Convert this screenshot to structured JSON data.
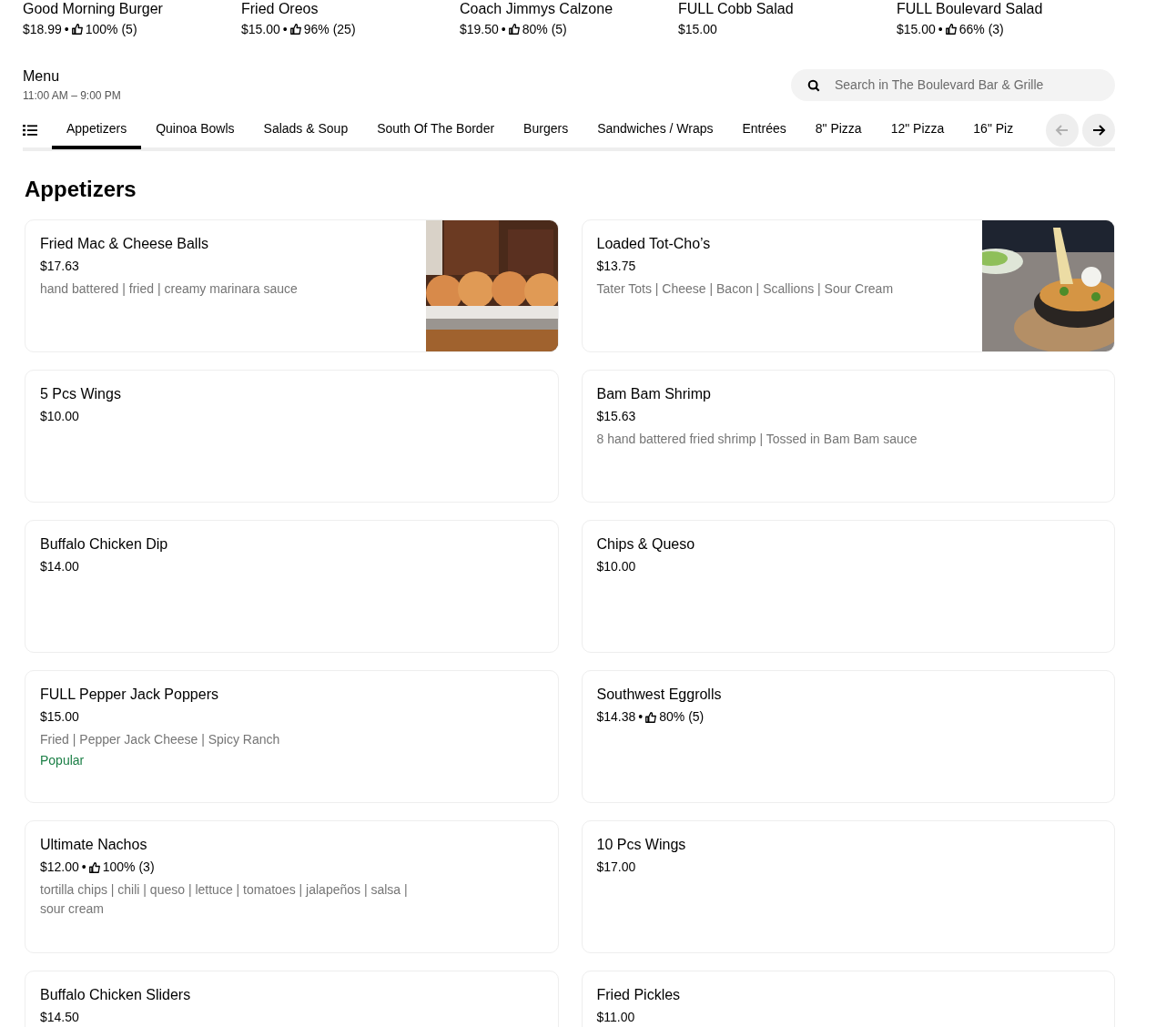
{
  "featured": [
    {
      "name": "Good Morning Burger",
      "price": "$18.99",
      "rating": "100% (5)"
    },
    {
      "name": "Fried Oreos",
      "price": "$15.00",
      "rating": "96% (25)"
    },
    {
      "name": "Coach Jimmys Calzone",
      "price": "$19.50",
      "rating": "80% (5)"
    },
    {
      "name": "FULL Cobb Salad",
      "price": "$15.00"
    },
    {
      "name": "FULL Boulevard Salad",
      "price": "$15.00",
      "rating": "66% (3)"
    }
  ],
  "separator": "•",
  "menu": {
    "title": "Menu",
    "hours": "11:00 AM – 9:00 PM"
  },
  "search": {
    "placeholder": "Search in The Boulevard Bar & Grille"
  },
  "tabs": [
    {
      "label": "Appetizers",
      "selected": true
    },
    {
      "label": "Quinoa Bowls",
      "selected": false
    },
    {
      "label": "Salads & Soup",
      "selected": false
    },
    {
      "label": "South Of The Border",
      "selected": false
    },
    {
      "label": "Burgers",
      "selected": false
    },
    {
      "label": "Sandwiches / Wraps",
      "selected": false
    },
    {
      "label": "Entrées",
      "selected": false
    },
    {
      "label": "8\" Pizza",
      "selected": false
    },
    {
      "label": "12\" Pizza",
      "selected": false
    },
    {
      "label": "16\" Piz",
      "selected": false
    }
  ],
  "scroll_buttons": [
    {
      "kind": "previous",
      "disabled": true
    },
    {
      "kind": "next",
      "disabled": false
    }
  ],
  "section": {
    "title": "Appetizers"
  },
  "items": [
    {
      "name": "Fried Mac & Cheese Balls",
      "price": "$17.63",
      "description": "hand battered | fried | creamy marinara sauce"
    },
    {
      "name": "Loaded Tot-Cho’s",
      "price": "$13.75",
      "description": "Tater Tots | Cheese | Bacon | Scallions | Sour Cream"
    },
    {
      "name": "5 Pcs Wings",
      "price": "$10.00"
    },
    {
      "name": "Bam Bam Shrimp",
      "price": "$15.63",
      "description": "8 hand battered fried shrimp | Tossed in Bam Bam sauce"
    },
    {
      "name": "Buffalo Chicken Dip",
      "price": "$14.00"
    },
    {
      "name": "Chips & Queso",
      "price": "$10.00"
    },
    {
      "name": "FULL Pepper Jack Poppers",
      "price": "$15.00",
      "description": "Fried | Pepper Jack Cheese | Spicy Ranch",
      "tag": "Popular"
    },
    {
      "name": "Southwest Eggrolls",
      "price": "$14.38",
      "rating": "80% (5)"
    },
    {
      "name": "Ultimate Nachos",
      "price": "$12.00",
      "rating": "100% (3)",
      "description": "tortilla chips | chili | queso | lettuce | tomatoes | jalapeños | salsa | sour cream"
    },
    {
      "name": "10 Pcs Wings",
      "price": "$17.00"
    },
    {
      "name": "Buffalo Chicken Sliders",
      "price": "$14.50"
    },
    {
      "name": "Fried Pickles",
      "price": "$11.00"
    }
  ]
}
